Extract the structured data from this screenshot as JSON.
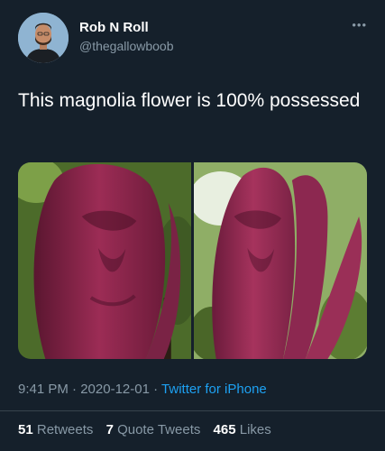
{
  "author": {
    "name": "Rob N Roll",
    "handle": "@thegallowboob"
  },
  "more_icon": "more-dots-icon",
  "tweet": {
    "text": "This magnolia flower is 100% possessed"
  },
  "media": {
    "photo_count": 2
  },
  "meta": {
    "time": "9:41 PM",
    "date": "2020-12-01",
    "separator": "·",
    "source": "Twitter for iPhone"
  },
  "stats": {
    "retweets_count": "51",
    "retweets_label": "Retweets",
    "quotes_count": "7",
    "quotes_label": "Quote Tweets",
    "likes_count": "465",
    "likes_label": "Likes"
  },
  "colors": {
    "background": "#15202b",
    "secondary_text": "#8899a6",
    "link": "#1da1f2",
    "divider": "#38444d"
  }
}
